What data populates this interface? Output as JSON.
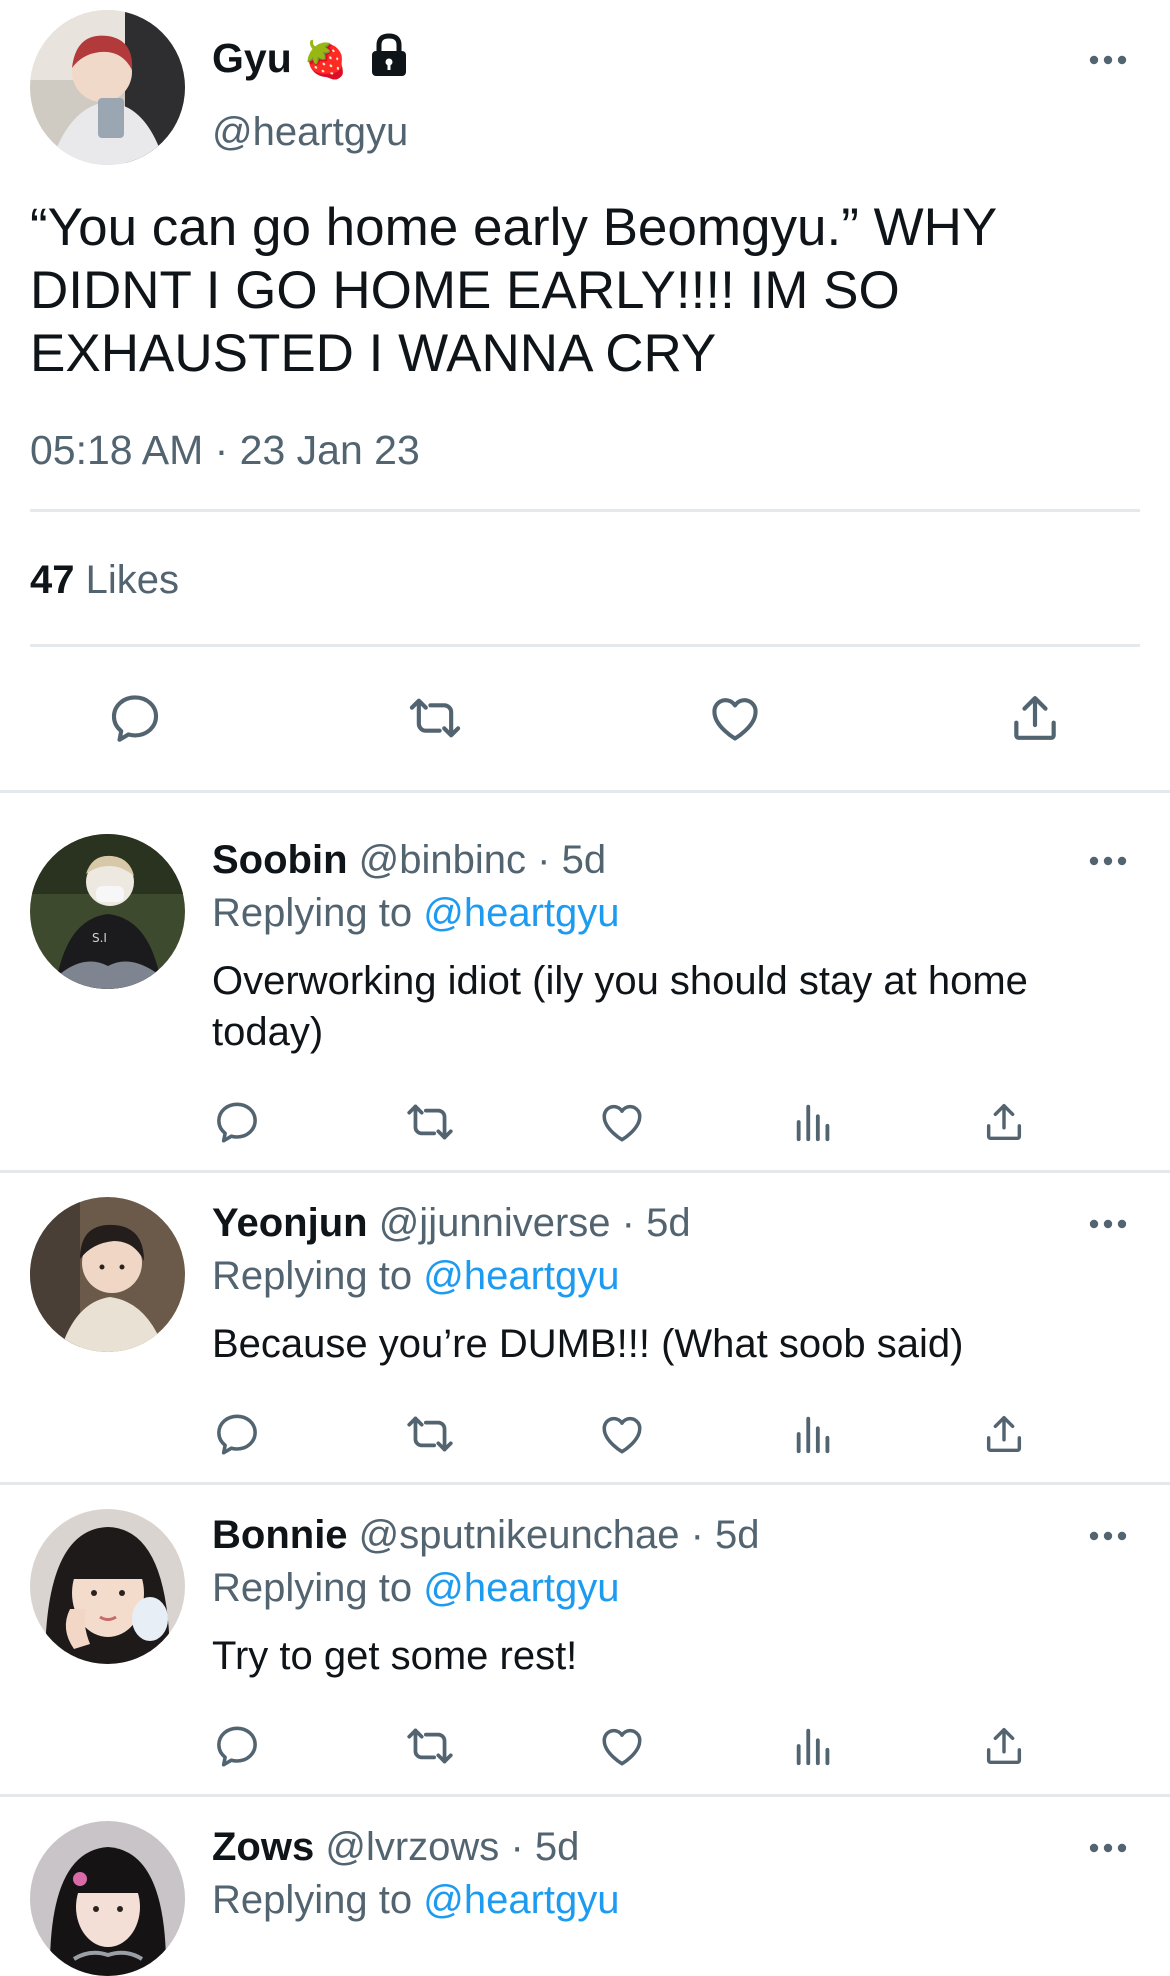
{
  "main_tweet": {
    "display_name": "Gyu",
    "handle": "@heartgyu",
    "text_lines": [
      "“You can go home early Beomgyu.” WHY",
      "DIDNT I GO HOME EARLY!!!! IM SO",
      "EXHAUSTED I WANNA CRY"
    ],
    "timestamp": "05:18 AM · 23 Jan 23",
    "likes_count": "47",
    "likes_label": "Likes",
    "name_emoji": "🍓"
  },
  "replies": [
    {
      "display_name": "Soobin",
      "handle": "@binbinc",
      "age": "· 5d",
      "replying_prefix": "Replying to",
      "replying_to": "@heartgyu",
      "text_lines": [
        "Overworking idiot (ily you should stay at home",
        "today)"
      ]
    },
    {
      "display_name": "Yeonjun",
      "handle": "@jjunniverse",
      "age": "· 5d",
      "replying_prefix": "Replying to",
      "replying_to": "@heartgyu",
      "text_lines": [
        "Because you’re DUMB!!! (What soob said)"
      ]
    },
    {
      "display_name": "Bonnie",
      "handle": "@sputnikeunchae",
      "age": "· 5d",
      "replying_prefix": "Replying to",
      "replying_to": "@heartgyu",
      "text_lines": [
        "Try to get some rest!"
      ]
    },
    {
      "display_name": "Zows",
      "handle": "@lvrzows",
      "age": "· 5d",
      "replying_prefix": "Replying to",
      "replying_to": "@heartgyu",
      "text_lines": []
    }
  ],
  "colors": {
    "text_primary": "#0f1419",
    "text_secondary": "#536471",
    "link": "#1d9bf0",
    "divider": "#e6e9ec"
  },
  "icons": {
    "lock": "lock-icon",
    "more": "more-icon",
    "reply": "reply-icon",
    "retweet": "retweet-icon",
    "like": "like-icon",
    "share": "share-icon",
    "analytics": "analytics-icon"
  }
}
